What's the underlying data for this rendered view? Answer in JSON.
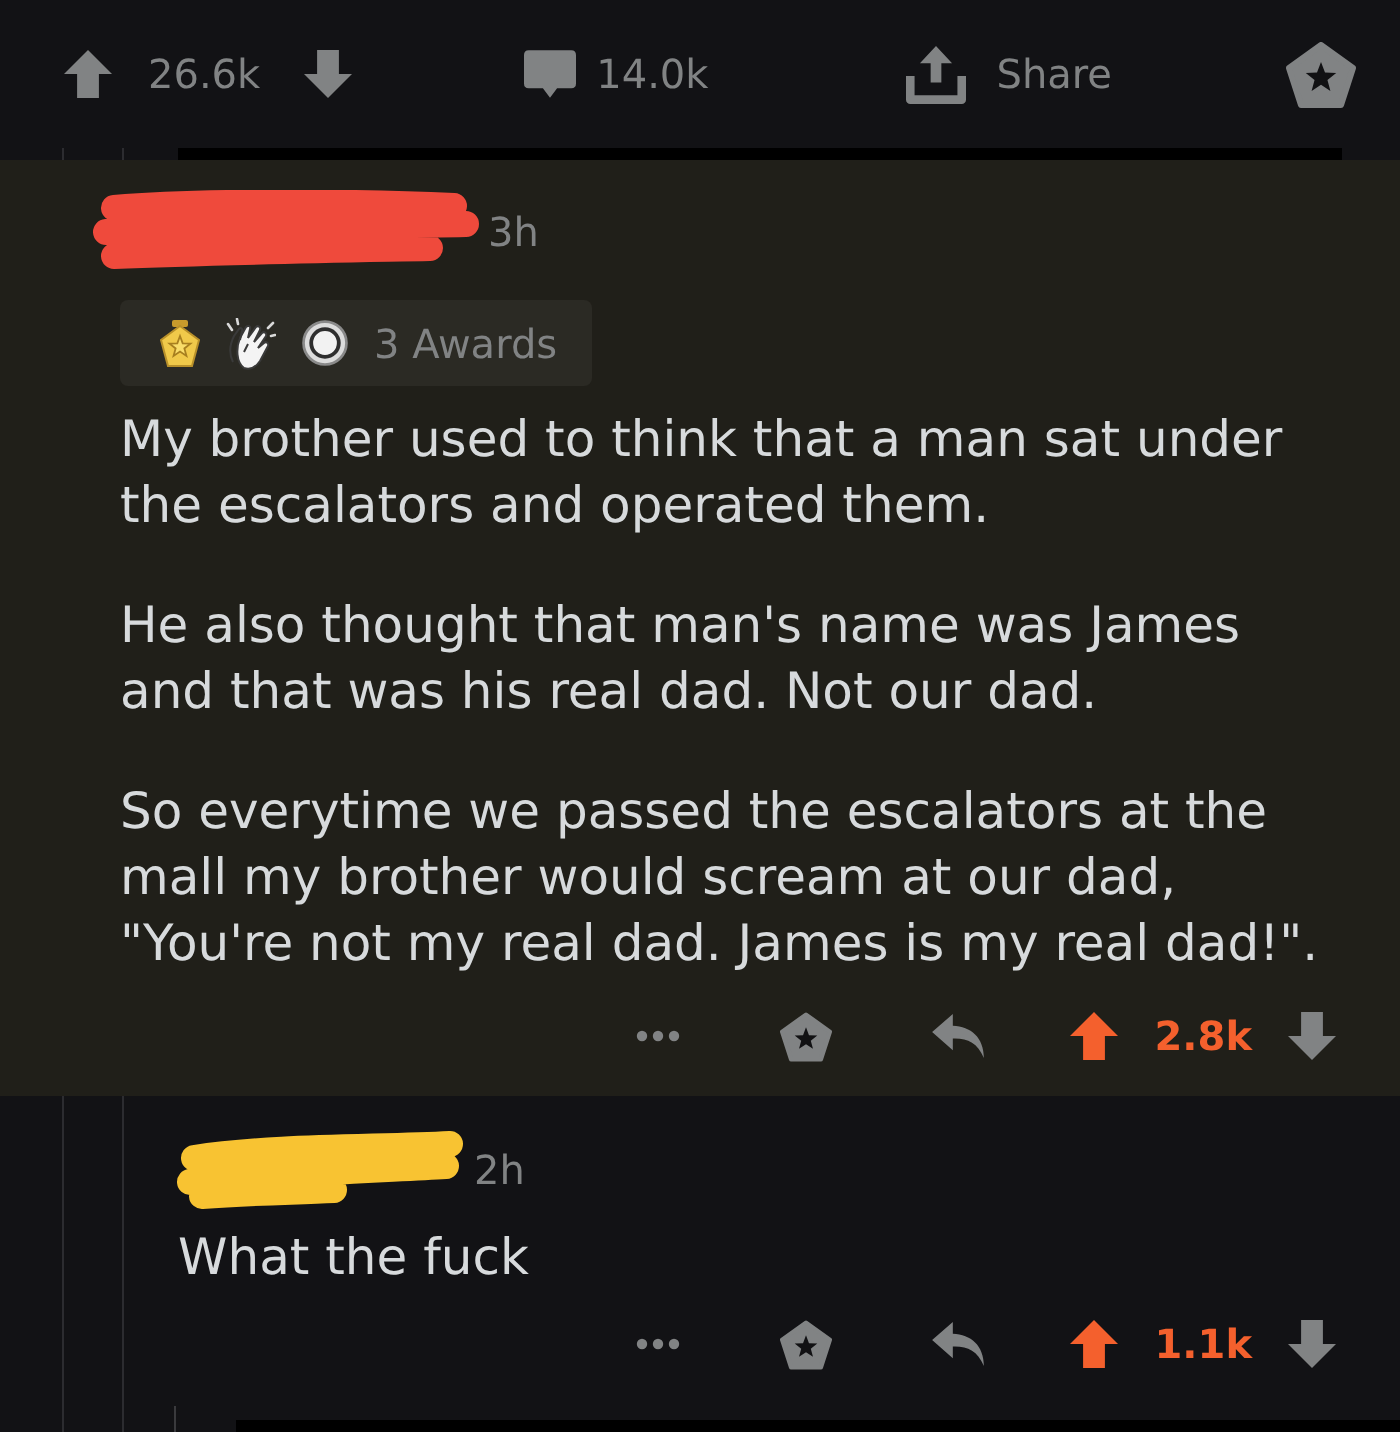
{
  "post_bar": {
    "upvoted": false,
    "score": "26.6k",
    "downvoted": false,
    "comments": "14.0k",
    "share": "Share"
  },
  "comments": [
    {
      "highlighted": true,
      "redaction": {
        "color": "#ef4a3c"
      },
      "age": "3h",
      "awards": {
        "items": [
          {
            "kind": "star"
          },
          {
            "kind": "clap"
          },
          {
            "kind": "silver"
          }
        ],
        "label": "3 Awards"
      },
      "paragraphs": [
        "My brother used to think that a man sat under the escalators and operated them.",
        "He also thought that man's name was James and that was his real dad. Not our dad.",
        "So everytime we passed the escalators at the mall my brother would scream at our dad, \"You're not my real dad. James is my real dad!\"."
      ],
      "upvoted": true,
      "score": "2.8k",
      "downvoted": false
    },
    {
      "highlighted": false,
      "redaction": {
        "color": "#f8c332"
      },
      "age": "2h",
      "paragraphs": [
        "What the fuck"
      ],
      "upvoted": true,
      "score": "1.1k",
      "downvoted": false
    }
  ]
}
